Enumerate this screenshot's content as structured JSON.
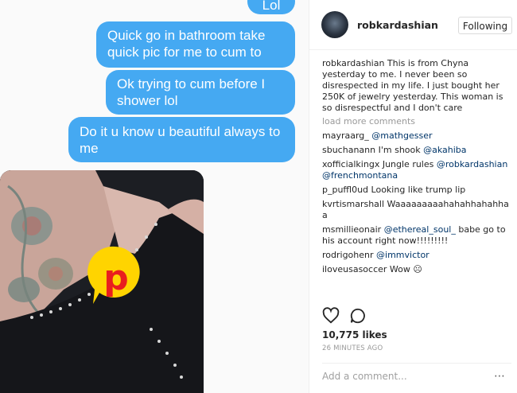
{
  "messages": [
    {
      "text": "Lol"
    },
    {
      "text": "Quick go in bathroom take quick pic for me to cum to"
    },
    {
      "text": "Ok trying to cum before I shower lol"
    },
    {
      "text": "Do it u know u beautiful always to me"
    }
  ],
  "photo": {
    "watermark_letter": "p",
    "watermark_color": "#e91e1e",
    "watermark_bg": "#ffd400"
  },
  "post": {
    "username": "robkardashian",
    "follow_label": "Following",
    "caption_user": "robkardashian",
    "caption_text": " This is from Chyna yesterday to me. I never been so disrespected in my life. I just bought her 250K of jewelry yesterday. This woman is so disrespectful and I don't care",
    "load_more": "load more comments",
    "comments": [
      {
        "user": "mayraarg_",
        "mention": "@mathgesser",
        "text": ""
      },
      {
        "user": "sbuchanann",
        "text": " I'm shook ",
        "mention": "@akahiba"
      },
      {
        "user": "xofficialkingx",
        "text": " Jungle rules ",
        "mention": "@robkardashian",
        "mention2": "@frenchmontana"
      },
      {
        "user": "p_puffl0ud",
        "text": " Looking like trump lip"
      },
      {
        "user": "kvrtismarshall",
        "text": " Waaaaaaaaahahahhahahhaa"
      },
      {
        "user": "msmillieonair",
        "mention": "@ethereal_soul_",
        "text": " babe go to his account right now!!!!!!!!!"
      },
      {
        "user": "rodrigohenr",
        "mention": "@immvictor"
      },
      {
        "user": "iloveusasoccer",
        "text": " Wow ☹"
      }
    ],
    "likes": "10,775 likes",
    "time": "26 MINUTES AGO",
    "add_comment_placeholder": "Add a comment...",
    "more_icon": "⋯"
  },
  "colors": {
    "bubble": "#45a9f2",
    "mention": "#003569"
  },
  "icons": [
    "heart-icon",
    "comment-icon",
    "more-options-icon"
  ]
}
